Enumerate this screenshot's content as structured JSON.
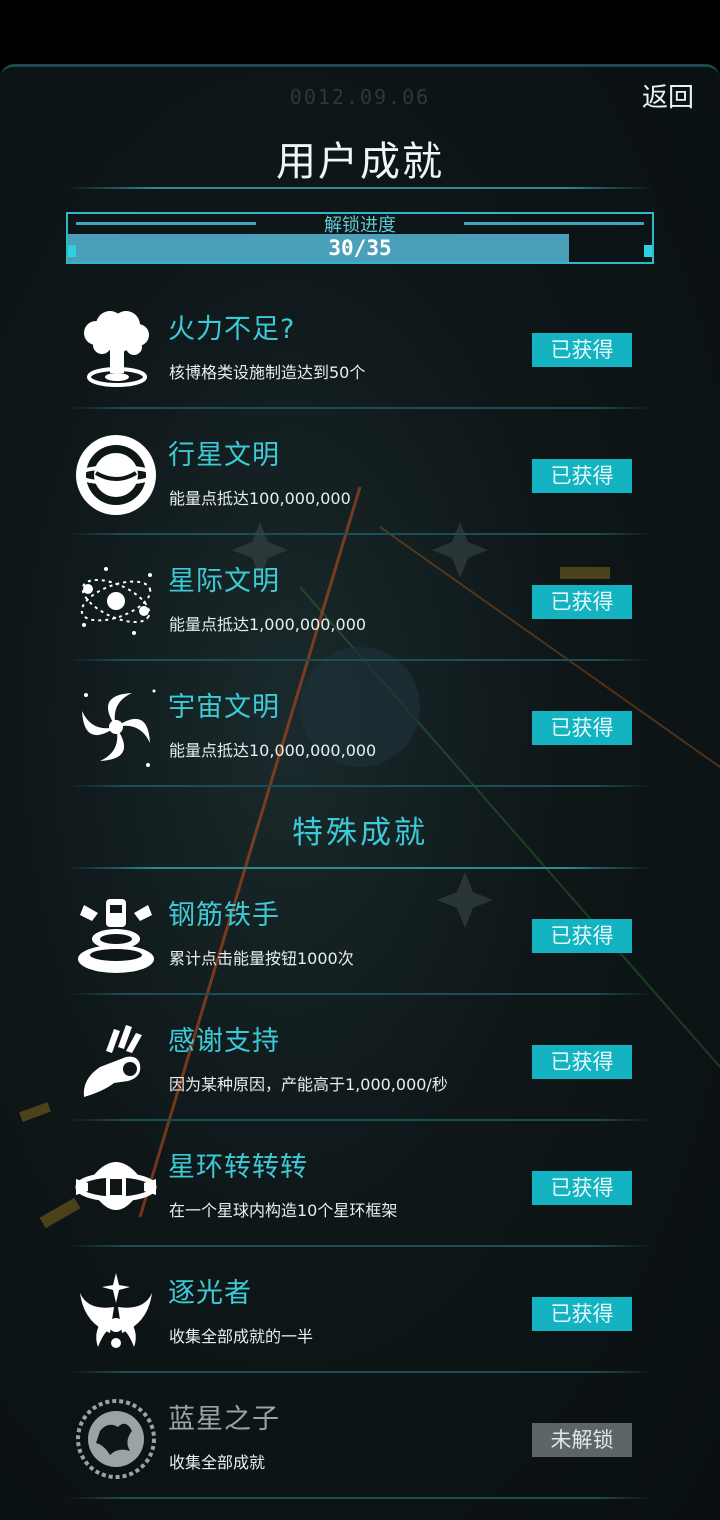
{
  "header": {
    "date": "0012.09.06",
    "back_label": "返回",
    "title": "用户成就"
  },
  "progress": {
    "label": "解锁进度",
    "text": "30/35",
    "unlocked": 30,
    "total": 35
  },
  "basic_achievements": [
    {
      "icon": "mushroom-cloud-icon",
      "name": "火力不足?",
      "desc": "核博格类设施制造达到50个",
      "status": "已获得"
    },
    {
      "icon": "planet-icon",
      "name": "行星文明",
      "desc": "能量点抵达100,000,000",
      "status": "已获得"
    },
    {
      "icon": "orbit-system-icon",
      "name": "星际文明",
      "desc": "能量点抵达1,000,000,000",
      "status": "已获得"
    },
    {
      "icon": "galaxy-spiral-icon",
      "name": "宇宙文明",
      "desc": "能量点抵达10,000,000,000",
      "status": "已获得"
    }
  ],
  "special_section_title": "特殊成就",
  "special_achievements": [
    {
      "icon": "pressing-button-icon",
      "name": "钢筋铁手",
      "desc": "累计点击能量按钮1000次",
      "status": "已获得"
    },
    {
      "icon": "ok-hand-icon",
      "name": "感谢支持",
      "desc": "因为某种原因，产能高于1,000,000/秒",
      "status": "已获得"
    },
    {
      "icon": "ring-frame-icon",
      "name": "星环转转转",
      "desc": "在一个星球内构造10个星环框架",
      "status": "已获得"
    },
    {
      "icon": "winged-star-icon",
      "name": "逐光者",
      "desc": "收集全部成就的一半",
      "status": "已获得"
    },
    {
      "icon": "blue-star-globe-icon",
      "name": "蓝星之子",
      "desc": "收集全部成就",
      "status": "未解锁"
    }
  ],
  "colors": {
    "accent": "#3ccad6",
    "badge_obtained": "#14b3c2",
    "badge_locked": "#5e6566",
    "progress_fill": "#4aa0b8"
  }
}
